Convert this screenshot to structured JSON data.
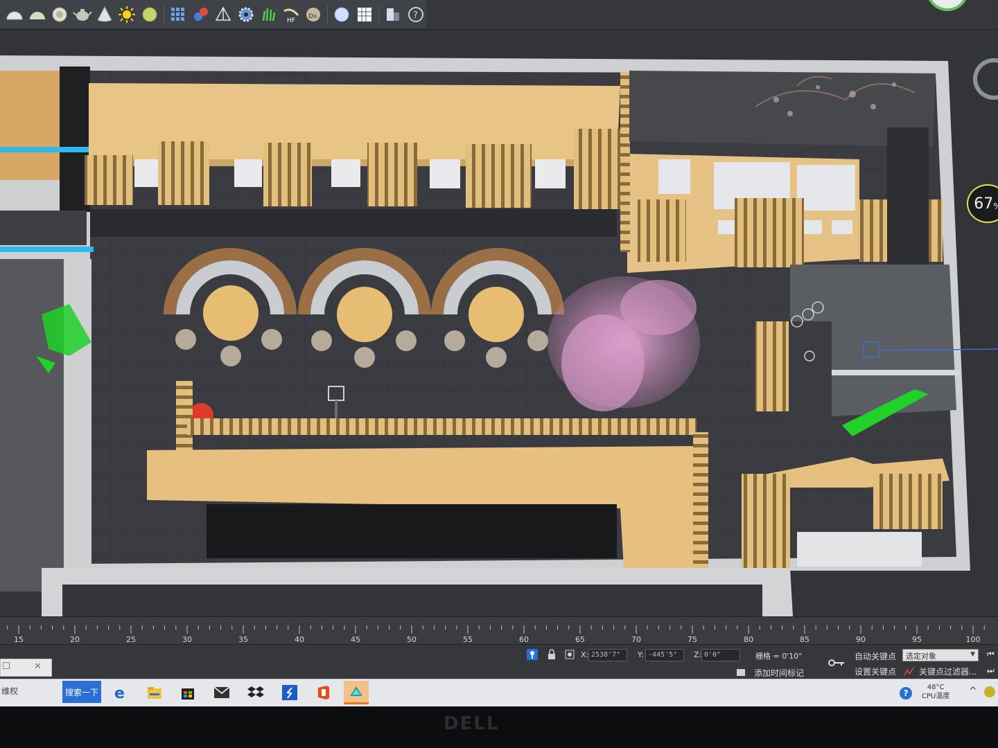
{
  "app": {
    "accent": "#f2f2f2"
  },
  "toolbar": {
    "icons": [
      "hemisphere-icon",
      "hemisphere-light-icon",
      "sphere-icon",
      "teapot-icon",
      "cone-icon",
      "sun-icon",
      "green-sphere-icon",
      "grid-icon",
      "dual-sphere-icon",
      "pyramid-icon",
      "gear-icon",
      "grass-icon",
      "hair-fur-icon",
      "displace-icon",
      "blue-sphere-icon",
      "grid-table-icon",
      "render-frame-icon",
      "help-icon"
    ],
    "help_label": "?"
  },
  "viewport": {
    "zoom_value": "67",
    "zoom_unit": "%"
  },
  "timeline": {
    "ticks": [
      15,
      20,
      25,
      30,
      35,
      40,
      45,
      50,
      55,
      60,
      65,
      70,
      75,
      80,
      85,
      90,
      95,
      100
    ]
  },
  "statusbar": {
    "x_label": "X:",
    "x_value": "2538'7\"",
    "y_label": "Y:",
    "y_value": "-445'5\"",
    "z_label": "Z:",
    "z_value": "0'0\"",
    "grid_text": "栅格 = 0'10\"",
    "add_time_tag": "添加时间标记",
    "auto_key": "自动关键点",
    "set_key": "设置关键点",
    "selection_select": "选定对象",
    "key_filters": "关键点过滤器..."
  },
  "taskbar": {
    "left_text": "维权",
    "search_label": "搜索一下",
    "apps": [
      "edge-icon",
      "file-explorer-icon",
      "store-icon",
      "mail-icon",
      "dropbox-icon",
      "sketchup-icon",
      "office-icon",
      "3dsmax-icon"
    ],
    "help": "?",
    "cpu_temp": "48°C",
    "cpu_label": "CPU温度"
  },
  "monitor": {
    "brand": "DELL"
  }
}
